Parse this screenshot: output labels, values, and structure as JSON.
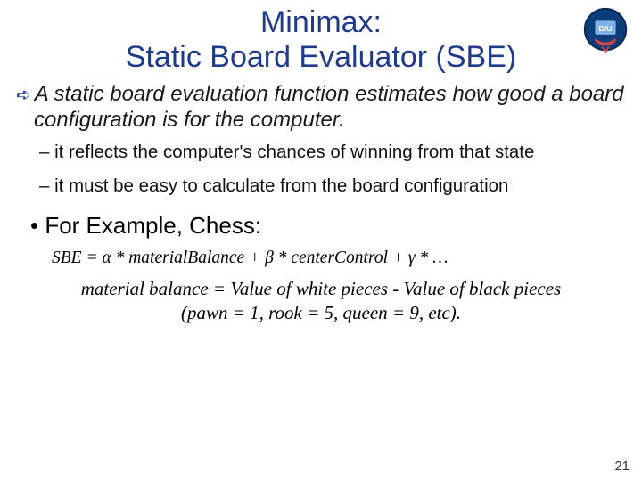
{
  "title_line1": "Minimax:",
  "title_line2": "Static Board Evaluator (SBE)",
  "lead": "A static board evaluation function estimates how good a board configuration is for the computer.",
  "sub1": "– it reflects the computer's chances of winning from that state",
  "sub2": "– it must be easy to calculate from the board configuration",
  "bullet": "•  For Example, Chess:",
  "formula": "SBE = α * materialBalance + β * centerControl + γ * …",
  "material1": "material balance = Value of white pieces - Value of black pieces",
  "material2": "(pawn = 1, rook = 5, queen = 9, etc).",
  "pagenum": "21",
  "logo_label": "DIU"
}
